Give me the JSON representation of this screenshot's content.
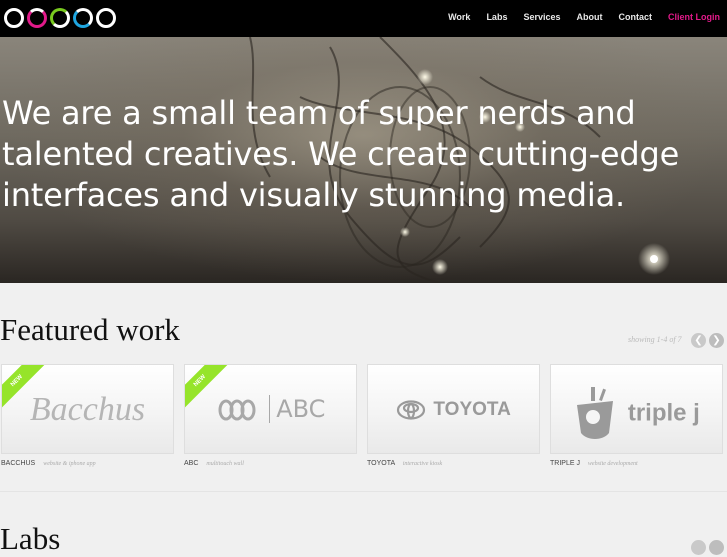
{
  "nav": {
    "items": [
      "Work",
      "Labs",
      "Services",
      "About",
      "Contact"
    ],
    "login": "Client Login",
    "colors": {
      "pink": "#e21a8a",
      "green": "#7acb1f",
      "blue": "#1fa6e0"
    }
  },
  "hero": {
    "text": "We are a small team of super nerds and talented creatives. We create cutting-edge interfaces and visually stunning media."
  },
  "featured": {
    "title": "Featured work",
    "showing": "showing 1-4 of 7",
    "cards": [
      {
        "logo": "Bacchus",
        "name": "BACCHUS",
        "desc": "website & iphone app",
        "badge": "NEW"
      },
      {
        "logo": "ABC",
        "name": "ABC",
        "desc": "multitouch wall",
        "badge": "NEW"
      },
      {
        "logo": "TOYOTA",
        "name": "TOYOTA",
        "desc": "interactive kiosk",
        "badge": ""
      },
      {
        "logo": "triple j",
        "name": "TRIPLE J",
        "desc": "website development",
        "badge": ""
      }
    ]
  },
  "labs": {
    "title": "Labs"
  },
  "icons": {
    "prev": "chevron-left-icon",
    "next": "chevron-right-icon"
  }
}
